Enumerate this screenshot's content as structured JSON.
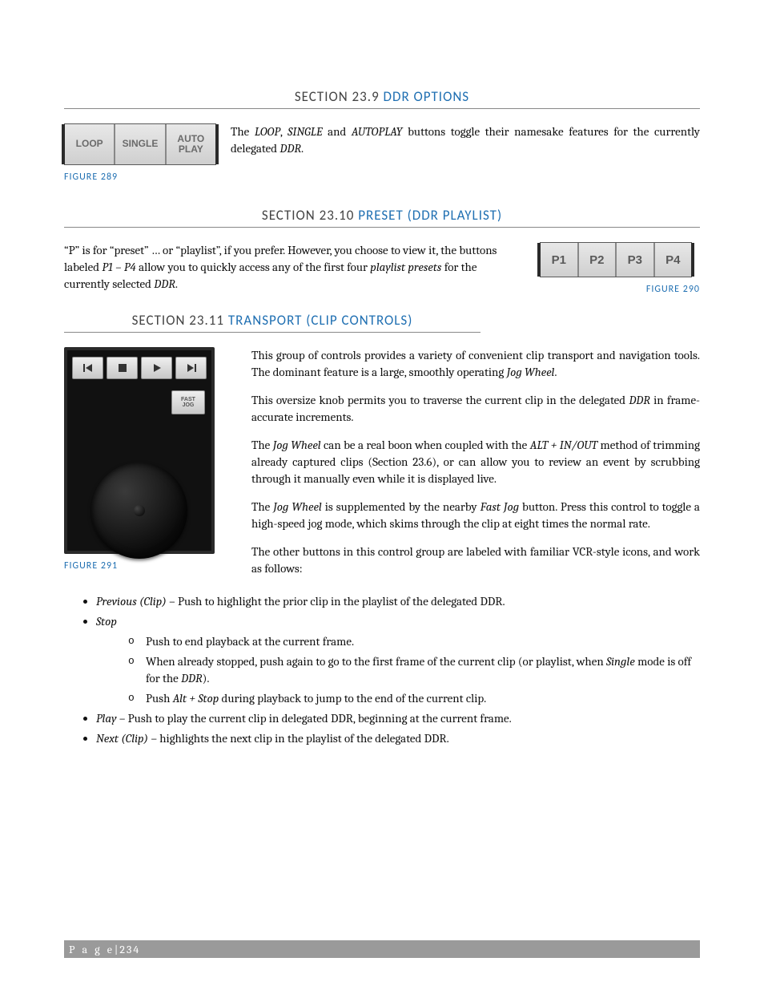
{
  "sections": {
    "s9": {
      "lead": "SECTION 23.9 ",
      "title": "DDR OPTIONS"
    },
    "s10": {
      "lead": "SECTION 23.10 ",
      "title": "PRESET (DDR PLAYLIST)"
    },
    "s11": {
      "lead": "SECTION 23.11 ",
      "title": "TRANSPORT (CLIP CONTROLS)"
    }
  },
  "figures": {
    "f289": "FIGURE 289",
    "f290": "FIGURE 290",
    "f291": "FIGURE 291",
    "btns289": [
      "LOOP",
      "SINGLE",
      "AUTO\nPLAY"
    ],
    "btns290": [
      "P1",
      "P2",
      "P3",
      "P4"
    ],
    "fastjog": "FAST\nJOG"
  },
  "para": {
    "s9p1_a": "The ",
    "s9p1_b": "LOOP",
    "s9p1_c": ", ",
    "s9p1_d": "SINGLE",
    "s9p1_e": " and ",
    "s9p1_f": "AUTOPLAY",
    "s9p1_g": " buttons toggle their namesake features for the currently delegated ",
    "s9p1_h": "DDR",
    "s9p1_i": ".",
    "s10p1_a": "“P” is for “preset” … or “playlist”, if you prefer.  However, you choose to view it, the buttons labeled ",
    "s10p1_b": "P1 – P4",
    "s10p1_c": " allow you to quickly access any of the first four ",
    "s10p1_d": "playlist presets",
    "s10p1_e": " for the currently selected ",
    "s10p1_f": "DDR",
    "s10p1_g": ".",
    "s11p1_a": "This group of controls provides a variety of convenient clip transport and navigation tools. The dominant feature is a large, smoothly operating ",
    "s11p1_b": "Jog Wheel",
    "s11p1_c": ".",
    "s11p2_a": "This oversize knob permits you to traverse the current clip in the delegated ",
    "s11p2_b": "DDR",
    "s11p2_c": " in frame-accurate increments.",
    "s11p3_a": "The ",
    "s11p3_b": "Jog Wheel",
    "s11p3_c": " can be a real boon when coupled with the ",
    "s11p3_d": "ALT + IN/OUT",
    "s11p3_e": " method of trimming already captured clips (Section 23.6), or can allow you to review an event by scrubbing through it manually even while it is displayed live.",
    "s11p4_a": "The ",
    "s11p4_b": "Jog Wheel",
    "s11p4_c": " is supplemented by the nearby ",
    "s11p4_d": "Fast Jog",
    "s11p4_e": " button.  Press this control to toggle a high-speed jog mode, which skims through the clip at eight times the normal rate.",
    "s11p5": "The other buttons in this control group are labeled with familiar VCR-style icons, and work as follows:",
    "li1_a": "Previous (Clip)",
    "li1_b": " – Push to highlight the prior clip in the playlist of the delegated DDR.",
    "li2_a": "Stop",
    "li2s1": "Push to end playback at the current frame.",
    "li2s2_a": "When already stopped, push again to go to the first frame of the current clip (or playlist, when ",
    "li2s2_b": "Single",
    "li2s2_c": " mode is off for the ",
    "li2s2_d": "DDR",
    "li2s2_e": ").",
    "li2s3_a": "Push ",
    "li2s3_b": "Alt + Stop",
    "li2s3_c": " during playback to jump to the end of the current clip.",
    "li3_a": "Play",
    "li3_b": " – Push to play the current clip in delegated DDR, beginning at the current frame.",
    "li4_a": "Next (Clip)",
    "li4_b": " – highlights the next clip in the playlist of the delegated DDR."
  },
  "footer": {
    "label": "P a g e",
    "sep": " | ",
    "num": "234"
  }
}
